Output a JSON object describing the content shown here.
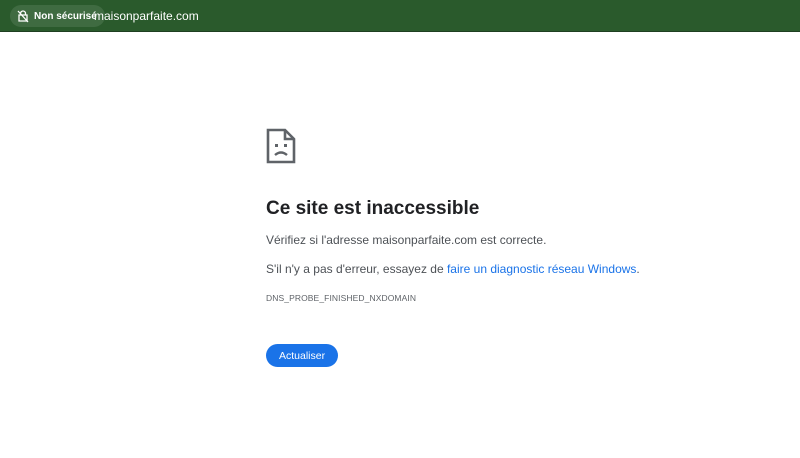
{
  "address_bar": {
    "security_label": "Non sécurisé",
    "security_icon": "not-secure-icon",
    "url": "maisonparfaite.com"
  },
  "error_page": {
    "icon": "sad-page-icon",
    "headline": "Ce site est inaccessible",
    "check_text": "Vérifiez si l'adresse maisonparfaite.com est correcte.",
    "suggestion_prefix": "S'il n'y a pas d'erreur, essayez de ",
    "suggestion_link": "faire un diagnostic réseau Windows",
    "suggestion_suffix": ".",
    "error_code": "DNS_PROBE_FINISHED_NXDOMAIN",
    "reload_label": "Actualiser"
  },
  "colors": {
    "toolbar": "#2a5a2c",
    "link": "#1a73e8",
    "button": "#1a73e8"
  }
}
